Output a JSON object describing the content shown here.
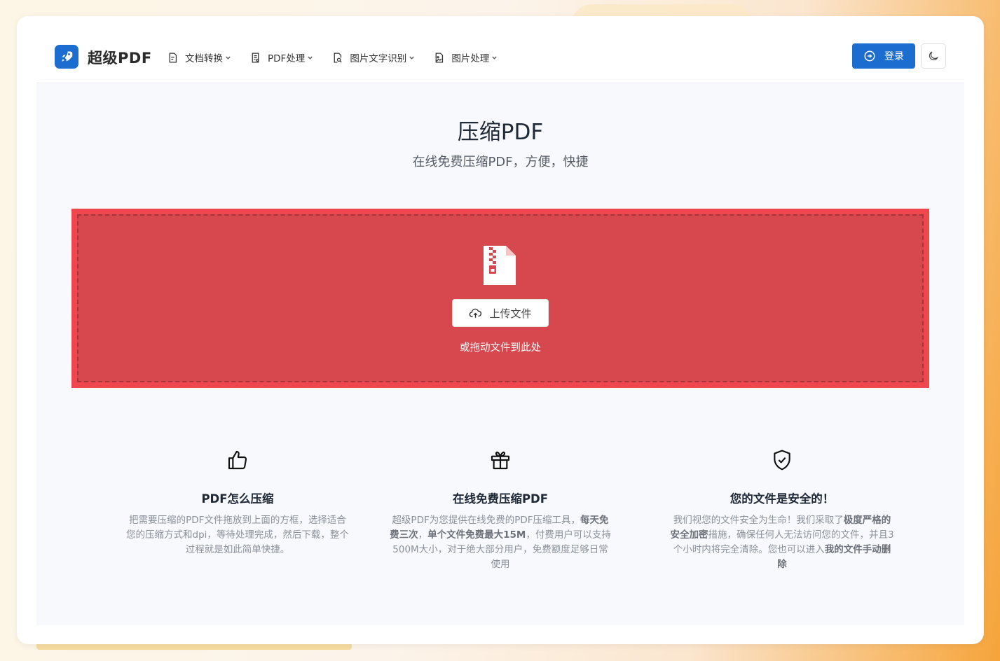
{
  "header": {
    "brand": "超级PDF",
    "nav": [
      {
        "label": "文档转换"
      },
      {
        "label": "PDF处理"
      },
      {
        "label": "图片文字识别"
      },
      {
        "label": "图片处理"
      }
    ],
    "login_label": "登录"
  },
  "hero": {
    "title": "压缩PDF",
    "subtitle": "在线免费压缩PDF，方便，快捷"
  },
  "dropzone": {
    "upload_label": "上传文件",
    "hint": "或拖动文件到此处"
  },
  "features": [
    {
      "icon": "thumbs-up-icon",
      "title": "PDF怎么压缩",
      "text": "把需要压缩的PDF文件拖放到上面的方框，选择适合您的压缩方式和dpi，等待处理完成，然后下载，整个过程就是如此简单快捷。"
    },
    {
      "icon": "gift-icon",
      "title": "在线免费压缩PDF",
      "text_1": "超级PDF为您提供在线免费的PDF压缩工具，",
      "bold_1": "每天免费三次",
      "text_2": "，",
      "bold_2": "单个文件免费最大15M",
      "text_3": "，付费用户可以支持500M大小，对于绝大部分用户，免费额度足够日常使用"
    },
    {
      "icon": "shield-check-icon",
      "title": "您的文件是安全的！",
      "text_1": "我们视您的文件安全为生命！我们采取了",
      "bold_1": "极度严格的安全加密",
      "text_2": "措施，确保任何人无法访问您的文件，并且3个小时内将完全清除。您也可以进入",
      "bold_2": "我的文件手动删除"
    }
  ],
  "colors": {
    "brand_blue": "#1c6dd0",
    "dropzone_red": "#d7484e",
    "dropzone_border": "#f0474f"
  }
}
